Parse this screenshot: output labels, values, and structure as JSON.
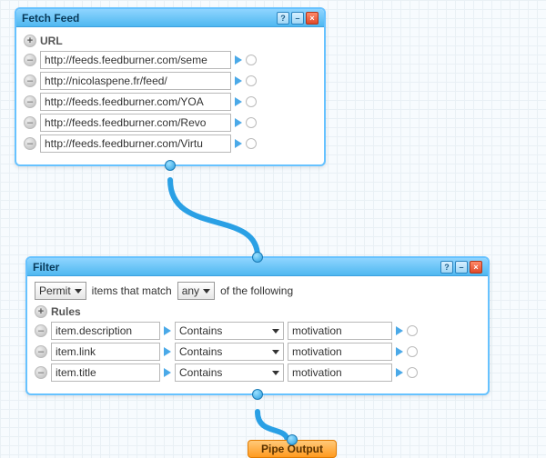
{
  "fetch": {
    "title": "Fetch Feed",
    "section_label": "URL",
    "urls": [
      "http://feeds.feedburner.com/seme",
      "http://nicolaspene.fr/feed/",
      "http://feeds.feedburner.com/YOA",
      "http://feeds.feedburner.com/Revo",
      "http://feeds.feedburner.com/Virtu"
    ]
  },
  "filter": {
    "title": "Filter",
    "topline": {
      "mode": "Permit",
      "text1": "items that match",
      "match": "any",
      "text2": "of the following"
    },
    "rules_label": "Rules",
    "rules": [
      {
        "field": "item.description",
        "op": "Contains",
        "value": "motivation"
      },
      {
        "field": "item.link",
        "op": "Contains",
        "value": "motivation"
      },
      {
        "field": "item.title",
        "op": "Contains",
        "value": "motivation"
      }
    ]
  },
  "output": {
    "label": "Pipe Output"
  },
  "icons": {
    "help": "?",
    "minimize": "–",
    "close": "×",
    "plus": "+",
    "minus": "–"
  }
}
